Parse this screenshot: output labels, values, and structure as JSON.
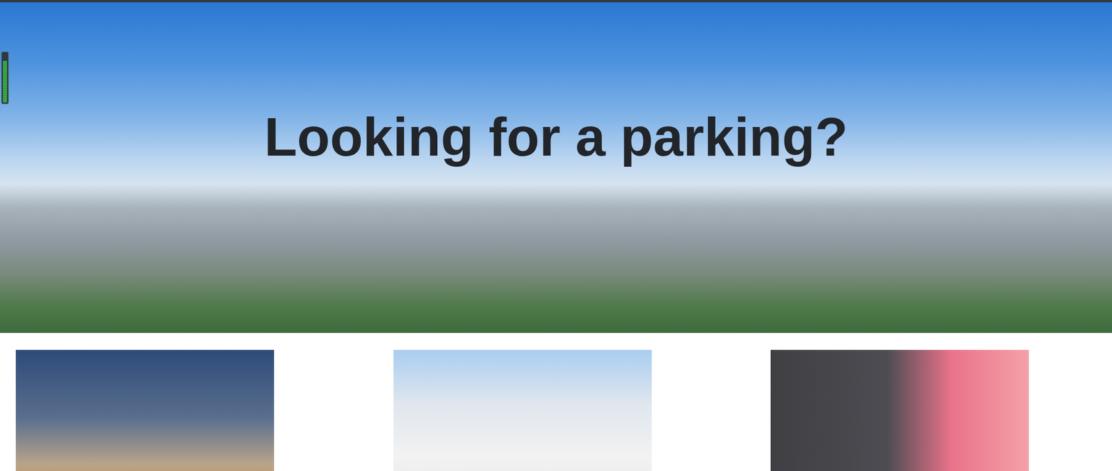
{
  "hero": {
    "heading": "Looking for a parking?"
  },
  "side_widget": {
    "level": 0.85
  },
  "cards": [
    {
      "kind": "photo"
    },
    {
      "kind": "photo"
    },
    {
      "kind": "photo"
    }
  ]
}
